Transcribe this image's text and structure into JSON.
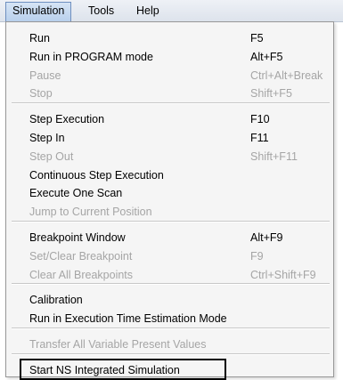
{
  "menubar": {
    "items": [
      {
        "label": "Simulation"
      },
      {
        "label": "Tools"
      },
      {
        "label": "Help"
      }
    ]
  },
  "menu": {
    "groups": [
      [
        {
          "label": "Run",
          "shortcut": "F5",
          "enabled": true
        },
        {
          "label": "Run in PROGRAM mode",
          "shortcut": "Alt+F5",
          "enabled": true
        },
        {
          "label": "Pause",
          "shortcut": "Ctrl+Alt+Break",
          "enabled": false
        },
        {
          "label": "Stop",
          "shortcut": "Shift+F5",
          "enabled": false
        }
      ],
      [
        {
          "label": "Step Execution",
          "shortcut": "F10",
          "enabled": true
        },
        {
          "label": "Step In",
          "shortcut": "F11",
          "enabled": true
        },
        {
          "label": "Step Out",
          "shortcut": "Shift+F11",
          "enabled": false
        },
        {
          "label": "Continuous Step Execution",
          "shortcut": "",
          "enabled": true
        },
        {
          "label": "Execute One Scan",
          "shortcut": "",
          "enabled": true
        },
        {
          "label": "Jump to Current Position",
          "shortcut": "",
          "enabled": false
        }
      ],
      [
        {
          "label": "Breakpoint Window",
          "shortcut": "Alt+F9",
          "enabled": true
        },
        {
          "label": "Set/Clear Breakpoint",
          "shortcut": "F9",
          "enabled": false
        },
        {
          "label": "Clear All Breakpoints",
          "shortcut": "Ctrl+Shift+F9",
          "enabled": false
        }
      ],
      [
        {
          "label": "Calibration",
          "shortcut": "",
          "enabled": true
        },
        {
          "label": "Run in Execution Time Estimation Mode",
          "shortcut": "",
          "enabled": true
        }
      ],
      [
        {
          "label": "Transfer All Variable Present Values",
          "shortcut": "",
          "enabled": false
        }
      ],
      [
        {
          "label": "Start NS Integrated Simulation",
          "shortcut": "",
          "enabled": true,
          "highlighted": true
        }
      ]
    ]
  }
}
